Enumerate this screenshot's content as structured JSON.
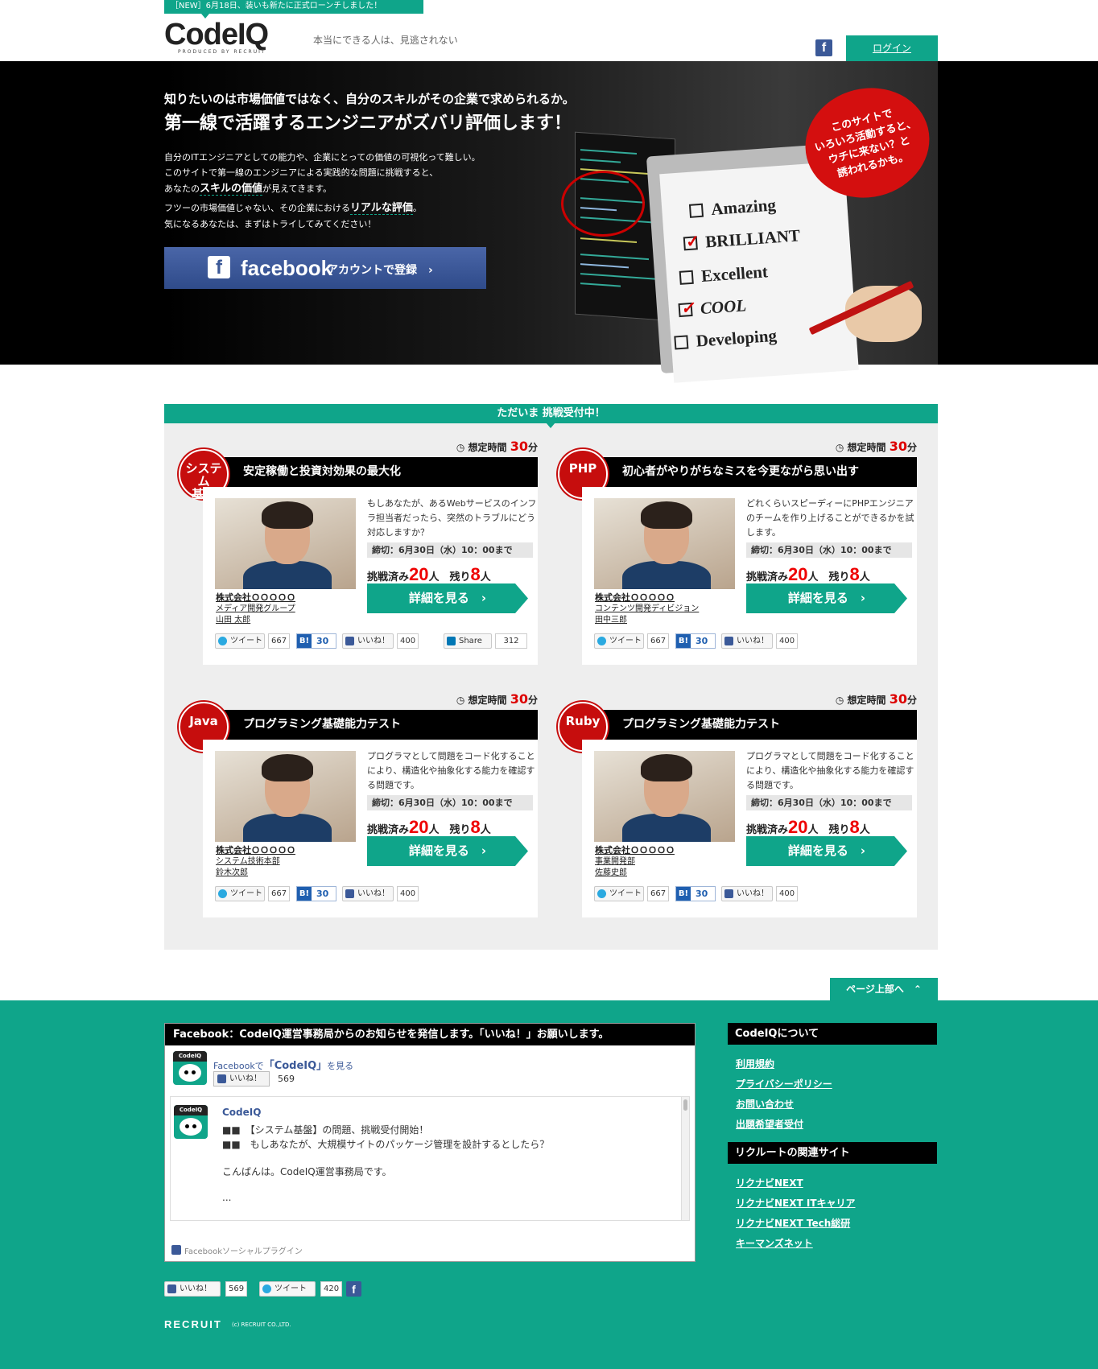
{
  "header": {
    "news": "［NEW］6月18日、装いも新たに正式ローンチしました！",
    "logo": "CodeIQ",
    "logo_sub": "PRODUCED BY RECRUIT",
    "tagline": "本当にできる人は、見逃されない",
    "login": "ログイン",
    "fb_icon": "f"
  },
  "hero": {
    "head1": "知りたいのは市場価値ではなく、自分のスキルがその企業で求められるか。",
    "head2": "第一線で活躍するエンジニアがズバリ評価します！",
    "p1": "自分のITエンジニアとしての能力や、企業にとっての価値の可視化って難しい。",
    "p2": "このサイトで第一線のエンジニアによる実践的な問題に挑戦すると、",
    "p3a": "あなたの",
    "p3b": "スキルの価値",
    "p3c": "が見えてきます。",
    "p4a": "フツーの市場価値じゃない、その企業における",
    "p4b": "リアルな評価",
    "p4c": "。",
    "p5": "気になるあなたは、まずはトライしてみてください！",
    "fb_f": "f",
    "fb_word": "facebook",
    "fb_label": "アカウントで登録　›",
    "badge": [
      "このサイトで",
      "いろいろ活動すると、",
      "ウチに来ない？と",
      "誘われるかも。"
    ],
    "checklist": [
      "Amazing",
      "BRILLIANT",
      "Excellent",
      "COOL",
      "Developing"
    ]
  },
  "challenges": {
    "heading": "ただいま 挑戦受付中！",
    "time_label": "想定時間",
    "cards": [
      {
        "badge": "システム\n基盤",
        "title": "安定稼働と投資対効果の最大化",
        "minutes": "30",
        "unit": "分",
        "desc": "もしあなたが、あるWebサービスのインフラ担当者だったら、突然のトラブルにどう対応しますか？",
        "deadline": "締切：6月30日（水）10：00まで",
        "done_label": "挑戦済み",
        "done": "20",
        "remain_label": "人　残り",
        "remain": "8",
        "person": "人",
        "detail": "詳細を見る　›",
        "company": "株式会社ＯＯＯＯＯ",
        "dept": "メディア開発グループ",
        "name": "山田 太郎",
        "tweet": "ツイート",
        "tweet_count": "667",
        "hatena": "30",
        "like": "いいね！",
        "like_count": "400",
        "li": "Share",
        "li_count": "312"
      },
      {
        "badge": "PHP",
        "title": "初心者がやりがちなミスを今更ながら思い出す",
        "minutes": "30",
        "unit": "分",
        "desc": "どれくらいスピーディーにPHPエンジニアのチームを作り上げることができるかを試します。",
        "deadline": "締切：6月30日（水）10：00まで",
        "done_label": "挑戦済み",
        "done": "20",
        "remain_label": "人　残り",
        "remain": "8",
        "person": "人",
        "detail": "詳細を見る　›",
        "company": "株式会社ＯＯＯＯＯ",
        "dept": "コンテンツ開発ディビジョン",
        "name": "田中三郎",
        "tweet": "ツイート",
        "tweet_count": "667",
        "hatena": "30",
        "like": "いいね！",
        "like_count": "400"
      },
      {
        "badge": "Java",
        "title": "プログラミング基礎能力テスト",
        "minutes": "30",
        "unit": "分",
        "desc": "プログラマとして問題をコード化することにより、構造化や抽象化する能力を確認する問題です。",
        "deadline": "締切：6月30日（水）10：00まで",
        "done_label": "挑戦済み",
        "done": "20",
        "remain_label": "人　残り",
        "remain": "8",
        "person": "人",
        "detail": "詳細を見る　›",
        "company": "株式会社ＯＯＯＯＯ",
        "dept": "システム技術本部",
        "name": "鈴木次郎",
        "tweet": "ツイート",
        "tweet_count": "667",
        "hatena": "30",
        "like": "いいね！",
        "like_count": "400"
      },
      {
        "badge": "Ruby",
        "title": "プログラミング基礎能力テスト",
        "minutes": "30",
        "unit": "分",
        "desc": "プログラマとして問題をコード化することにより、構造化や抽象化する能力を確認する問題です。",
        "deadline": "締切：6月30日（水）10：00まで",
        "done_label": "挑戦済み",
        "done": "20",
        "remain_label": "人　残り",
        "remain": "8",
        "person": "人",
        "detail": "詳細を見る　›",
        "company": "株式会社ＯＯＯＯＯ",
        "dept": "事業開発部",
        "name": "佐藤史郎",
        "tweet": "ツイート",
        "tweet_count": "667",
        "hatena": "30",
        "like": "いいね！",
        "like_count": "400"
      }
    ]
  },
  "footer": {
    "to_top": "ページ上部へ　⌃",
    "fb_title": "Facebook：CodeIQ運営事務局からのお知らせを発信します。「いいね！」お願いします。",
    "fb_link_pre": "Facebookで",
    "fb_link_name": "「CodeIQ」",
    "fb_link_post": "を見る",
    "fb_like": "いいね！",
    "fb_like_count": "569",
    "mascot_label": "CodeIQ",
    "feed_name": "CodeIQ",
    "feed_lines": [
      "■■　【システム基盤】の問題、挑戦受付開始！",
      "■■　もしあなたが、大規模サイトのパッケージ管理を設計するとしたら？",
      "こんばんは。CodeIQ運営事務局です。",
      "..."
    ],
    "fb_plugin": "Facebookソーシャルプラグイン",
    "about_head": "CodeIQについて",
    "about_links": [
      "利用規約",
      "プライバシーポリシー",
      "お問い合わせ",
      "出題希望者受付"
    ],
    "related_head": "リクルートの関連サイト",
    "related_links": [
      "リクナビNEXT",
      "リクナビNEXT ITキャリア",
      "リクナビNEXT Tech総研",
      "キーマンズネット"
    ],
    "share_like": "いいね！",
    "share_like_count": "569",
    "share_tweet": "ツイート",
    "share_tweet_count": "420",
    "share_fb": "f",
    "recruit": "RECRUIT",
    "copyright": "(c) RECRUIT CO.,LTD."
  },
  "colors": {
    "accent": "#0fa58a",
    "badge_red": "#c60d0d",
    "facebook": "#3b5998"
  }
}
